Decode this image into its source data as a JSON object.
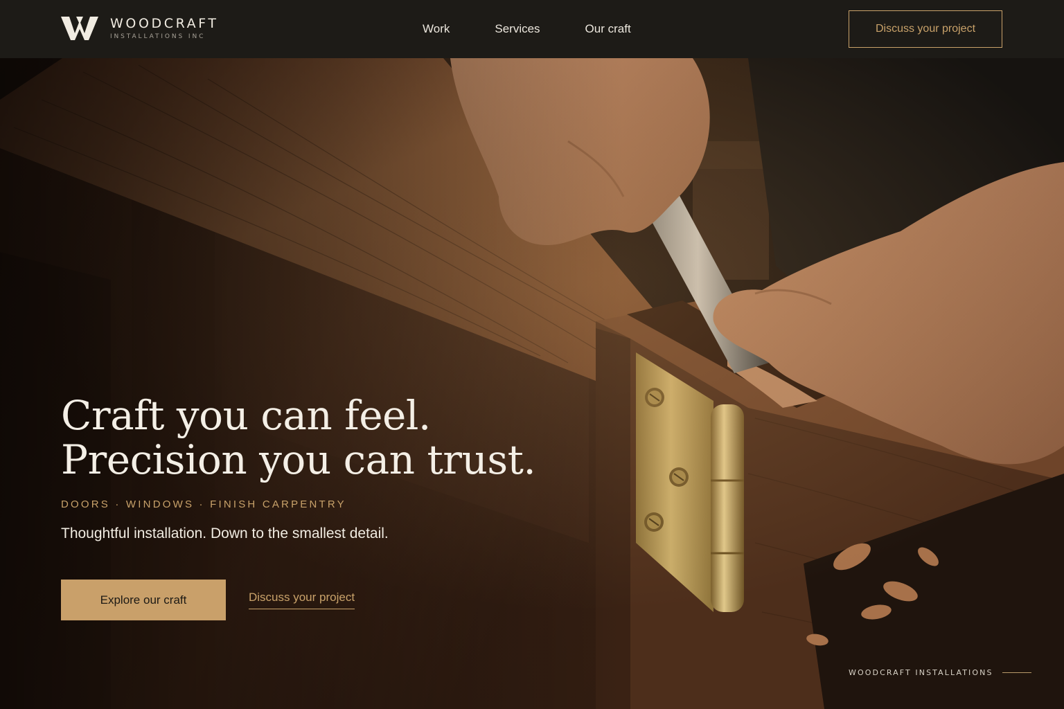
{
  "brand": {
    "name": "WOODCRAFT",
    "subtitle": "INSTALLATIONS INC",
    "logo_icon": "w-monogram-icon"
  },
  "nav": {
    "items": [
      {
        "label": "Work"
      },
      {
        "label": "Services"
      },
      {
        "label": "Our craft"
      }
    ]
  },
  "header": {
    "cta_label": "Discuss your project"
  },
  "hero": {
    "headline_line1": "Craft you can feel.",
    "headline_line2": "Precision you can trust.",
    "eyebrow": "DOORS · WINDOWS · FINISH CARPENTRY",
    "tagline": "Thoughtful installation. Down to the smallest detail.",
    "primary_cta": "Explore our craft",
    "secondary_cta": "Discuss your project",
    "footer_label": "WOODCRAFT INSTALLATIONS",
    "image_subject": "hands chiseling a hinge mortise in a walnut door"
  },
  "colors": {
    "header_bg": "#1d1b17",
    "accent_gold": "#c9a26a",
    "button_fill": "#c9a06a",
    "text_light": "#f4efe6",
    "wood_dark": "#2b1a10",
    "wood_mid": "#6b4226",
    "brass": "#b79a55"
  }
}
